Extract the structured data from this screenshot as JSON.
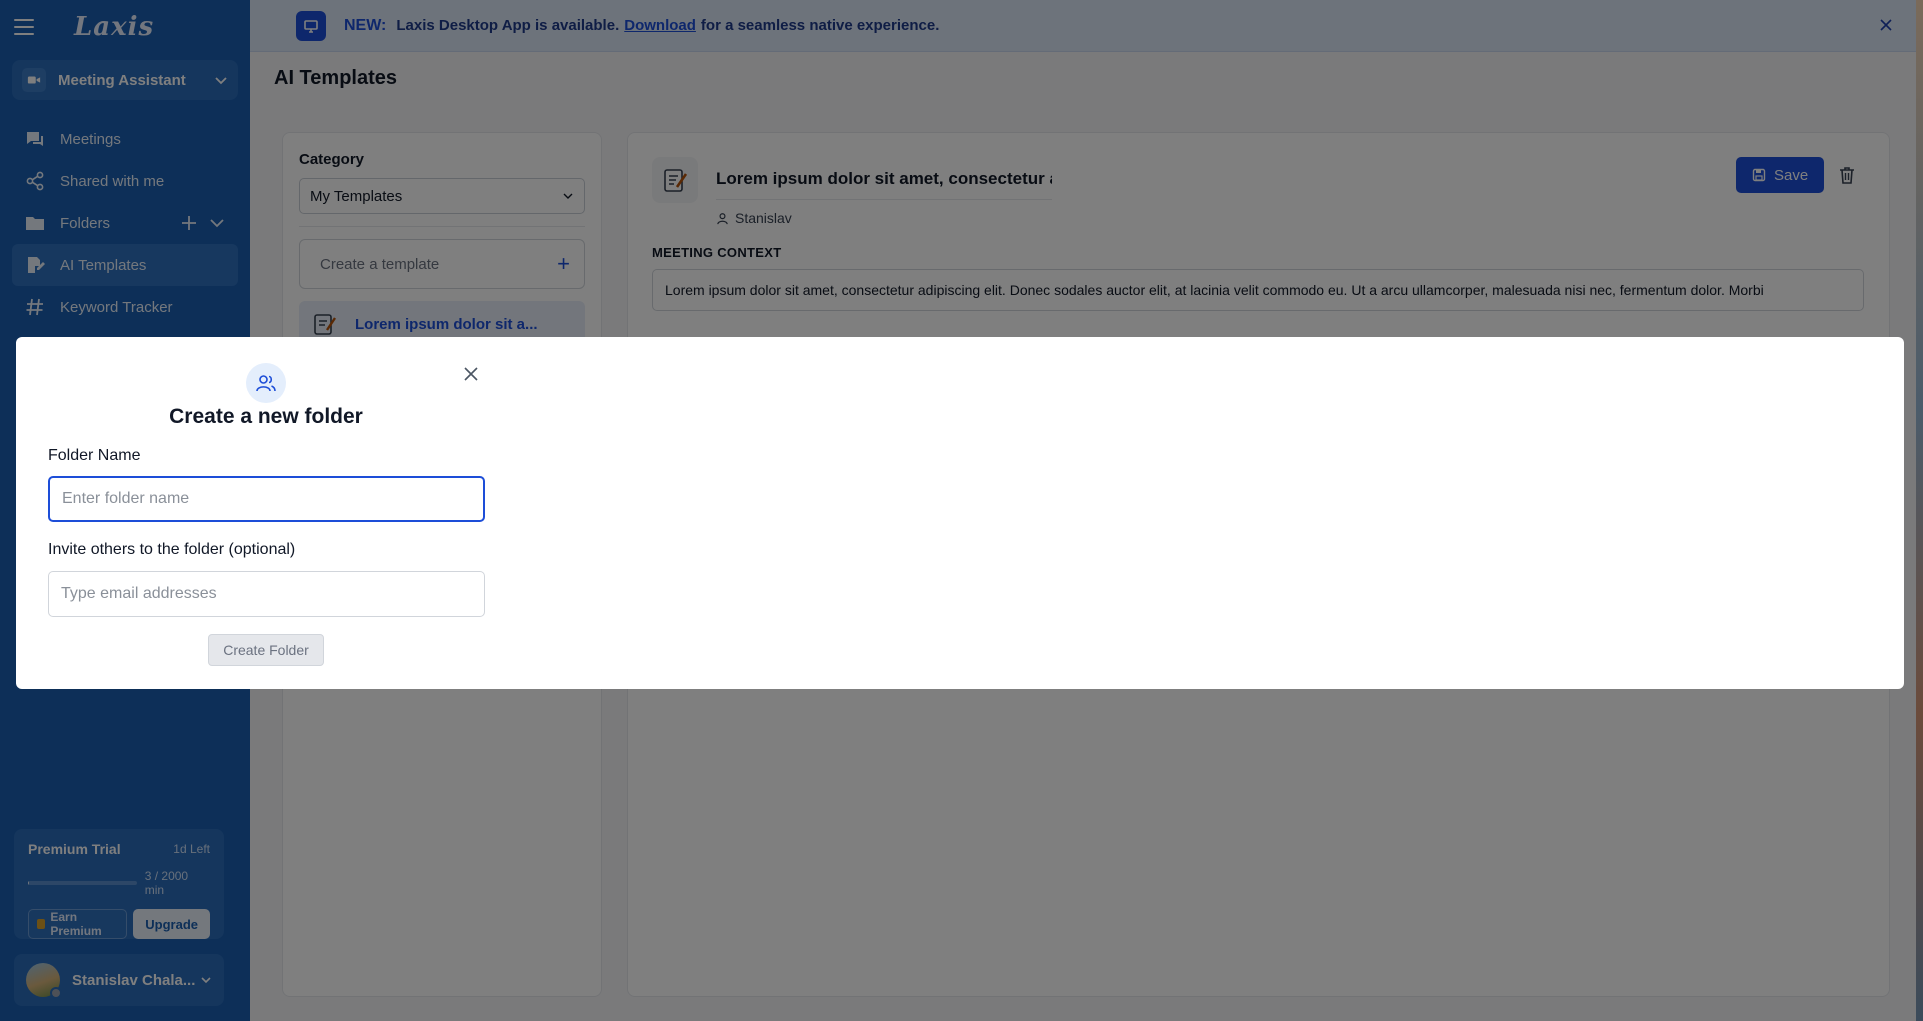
{
  "app": {
    "logo_text": "Laxis"
  },
  "sidebar": {
    "assistant_label": "Meeting Assistant",
    "items": [
      {
        "label": "Meetings",
        "icon": "chat-icon"
      },
      {
        "label": "Shared with me",
        "icon": "share-icon"
      },
      {
        "label": "Folders",
        "icon": "folder-icon"
      },
      {
        "label": "AI Templates",
        "icon": "templates-icon",
        "active": true
      },
      {
        "label": "Keyword Tracker",
        "icon": "hash-icon"
      }
    ],
    "trial": {
      "title": "Premium Trial",
      "left": "1d Left",
      "usage": "3 / 2000 min",
      "progress_fraction": 0.0015,
      "earn_label": "Earn Premium",
      "upgrade_label": "Upgrade"
    },
    "user_name": "Stanislav Chala..."
  },
  "banner": {
    "new_label": "NEW:",
    "text_before": "Laxis Desktop App is available.",
    "link": "Download",
    "text_after": "for a seamless native experience."
  },
  "page": {
    "title": "AI Templates"
  },
  "left_panel": {
    "category_label": "Category",
    "category_value": "My Templates",
    "create_label": "Create a template",
    "template_item": "Lorem ipsum dolor sit a..."
  },
  "editor": {
    "title": "Lorem ipsum dolor sit amet, consectetur a",
    "author": "Stanislav",
    "save_label": "Save",
    "context_label": "MEETING CONTEXT",
    "context_text": "Lorem ipsum dolor sit amet, consectetur adipiscing elit. Donec sodales auctor elit, at lacinia velit commodo eu. Ut a arcu ullamcorper, malesuada nisi nec, fermentum dolor. Morbi"
  },
  "modal": {
    "title": "Create a new folder",
    "folder_label": "Folder Name",
    "folder_placeholder": "Enter folder name",
    "invite_label": "Invite others to the folder (optional)",
    "invite_placeholder": "Type email addresses",
    "create_label": "Create Folder"
  },
  "colors": {
    "sidebar": "#1b5fb0",
    "accent": "#1d4ed8",
    "banner": "#dbe7f7"
  }
}
